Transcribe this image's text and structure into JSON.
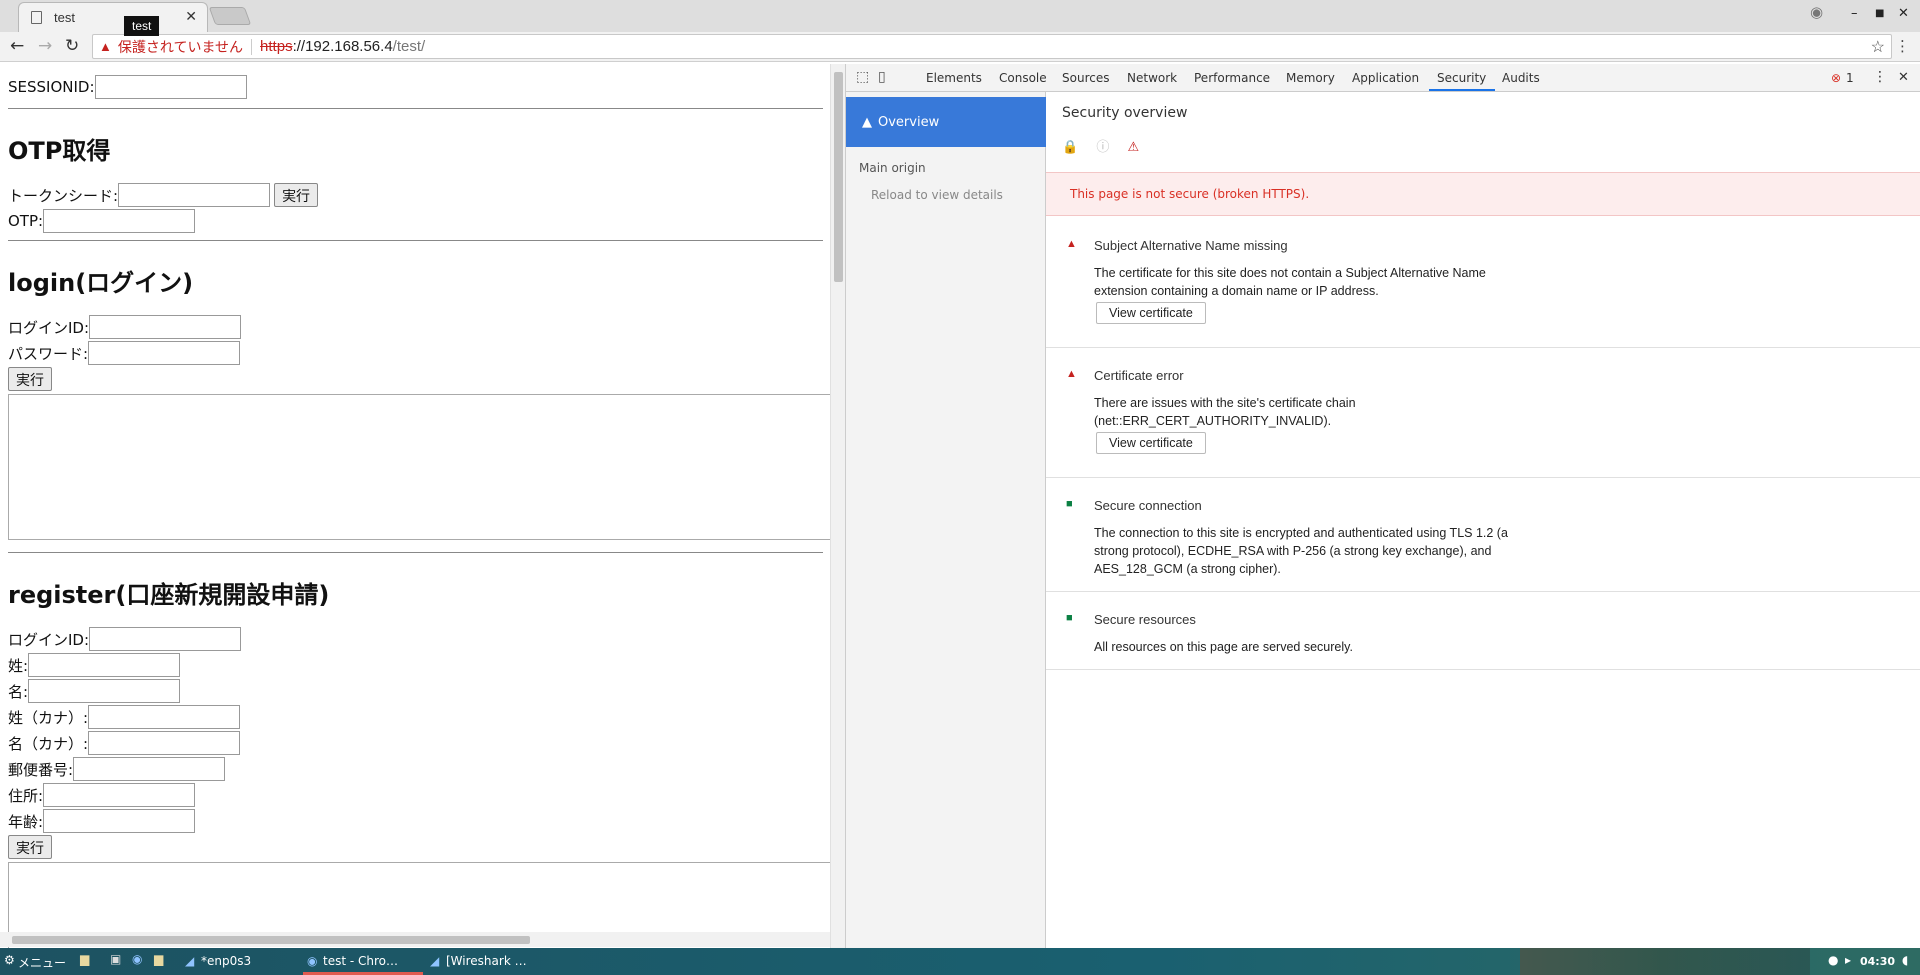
{
  "window": {
    "tab_title": "test",
    "tab_tooltip": "test",
    "tab_close": "✕",
    "profile_icon": "person-icon",
    "controls": {
      "minimize": "–",
      "maximize": "■",
      "close": "✕"
    }
  },
  "omnibox": {
    "warning_icon": "▲",
    "status": "保護されていません",
    "scheme": "https",
    "host": "://192.168.56.4",
    "path": "/test/"
  },
  "page": {
    "sessionid_label": "SESSIONID:",
    "otp_heading": "OTP取得",
    "token_seed_label": "トークンシード:",
    "run_label": "実行",
    "otp_label": "OTP:",
    "login_heading": "login(ログイン)",
    "login_id_label": "ログインID:",
    "password_label": "パスワード:",
    "register_heading": "register(口座新規開設申請)",
    "reg_login_id_label": "ログインID:",
    "last_name_label": "姓:",
    "first_name_label": "名:",
    "last_name_kana_label": "姓（カナ）:",
    "first_name_kana_label": "名（カナ）:",
    "postal_label": "郵便番号:",
    "address_label": "住所:",
    "age_label": "年齢:"
  },
  "devtools": {
    "tabs": [
      "Elements",
      "Console",
      "Sources",
      "Network",
      "Performance",
      "Memory",
      "Application",
      "Security",
      "Audits"
    ],
    "active_tab": "Security",
    "error_count": "1",
    "sidebar": {
      "overview": "Overview",
      "main_origin": "Main origin",
      "reload": "Reload to view details"
    },
    "overview_title": "Security overview",
    "banner": "This page is not secure (broken HTTPS).",
    "items": [
      {
        "status": "error",
        "title": "Subject Alternative Name missing",
        "desc": "The certificate for this site does not contain a Subject Alternative Name extension containing a domain name or IP address.",
        "button": "View certificate"
      },
      {
        "status": "error",
        "title": "Certificate error",
        "desc": "There are issues with the site's certificate chain (net::ERR_CERT_AUTHORITY_INVALID).",
        "button": "View certificate"
      },
      {
        "status": "secure",
        "title": "Secure connection",
        "desc": "The connection to this site is encrypted and authenticated using TLS 1.2 (a strong protocol), ECDHE_RSA with P-256 (a strong key exchange), and AES_128_GCM (a strong cipher)."
      },
      {
        "status": "secure",
        "title": "Secure resources",
        "desc": "All resources on this page are served securely."
      }
    ]
  },
  "taskbar": {
    "menu": "メニュー",
    "items": [
      "*enp0s3",
      "test - Chro…",
      "[Wireshark …"
    ],
    "clock": "04:30"
  },
  "colors": {
    "accent": "#1a73e8",
    "error": "#c5221f",
    "secure": "#0b8043",
    "overview_bg": "#3879d9"
  }
}
